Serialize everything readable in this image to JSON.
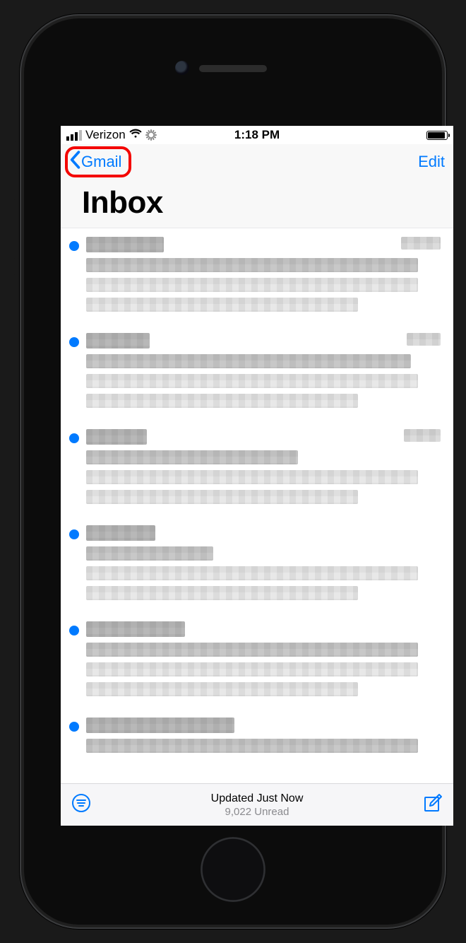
{
  "status_bar": {
    "carrier": "Verizon",
    "time": "1:18 PM"
  },
  "nav": {
    "back_label": "Gmail",
    "edit_label": "Edit"
  },
  "title": "Inbox",
  "messages": [
    {
      "unread": true,
      "sender_w": 110,
      "time_w": 56,
      "subject_w": 470,
      "preview_w": 470
    },
    {
      "unread": true,
      "sender_w": 90,
      "time_w": 48,
      "subject_w": 460,
      "preview_w": 470
    },
    {
      "unread": true,
      "sender_w": 86,
      "time_w": 52,
      "subject_w": 300,
      "preview_w": 470
    },
    {
      "unread": true,
      "sender_w": 98,
      "time_w": 0,
      "subject_w": 180,
      "preview_w": 470
    },
    {
      "unread": true,
      "sender_w": 140,
      "time_w": 0,
      "subject_w": 470,
      "preview_w": 470
    },
    {
      "unread": true,
      "sender_w": 210,
      "time_w": 0,
      "subject_w": 470,
      "preview_w": 0
    }
  ],
  "toolbar": {
    "status": "Updated Just Now",
    "substatus": "9,022 Unread"
  },
  "colors": {
    "tint": "#007aff",
    "highlight": "#f40500"
  }
}
